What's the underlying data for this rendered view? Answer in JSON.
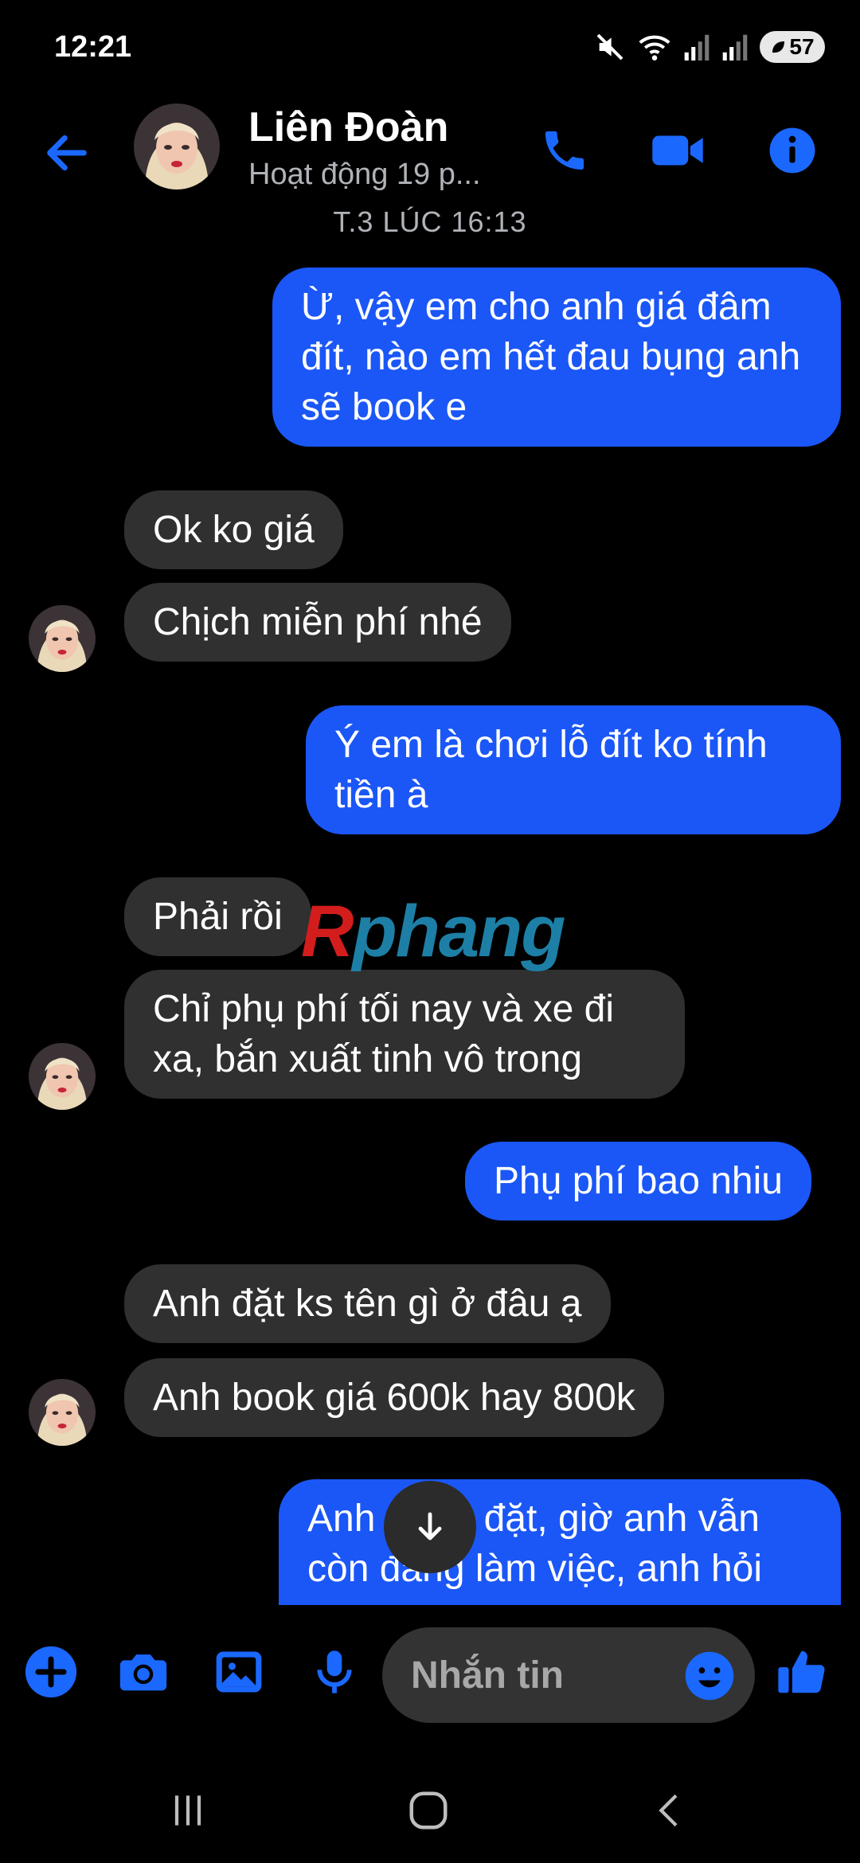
{
  "status_bar": {
    "time": "12:21",
    "battery": "57"
  },
  "header": {
    "contact_name": "Liên Đoàn",
    "contact_status": "Hoạt động 19 p..."
  },
  "timestamp": "T.3 LÚC 16:13",
  "messages": [
    {
      "side": "out",
      "text": "Ừ, vậy em cho anh giá đâm đít, nào em hết đau bụng anh sẽ book e"
    },
    {
      "side": "in",
      "text": "Ok ko giá"
    },
    {
      "side": "in",
      "text": "Chịch miễn phí nhé"
    },
    {
      "side": "out",
      "text": "Ý em là chơi lỗ đít ko tính tiền à"
    },
    {
      "side": "in",
      "text": "Phải rồi"
    },
    {
      "side": "in",
      "text": "Chỉ phụ phí tối nay và xe đi xa, bắn xuất tinh vô trong"
    },
    {
      "side": "out",
      "text": "Phụ phí bao nhiu"
    },
    {
      "side": "in",
      "text": "Anh đặt ks tên gì ở đâu ạ"
    },
    {
      "side": "in",
      "text": "Anh book giá 600k hay 800k"
    },
    {
      "side": "out",
      "text": "Anh chưa đặt, giờ anh vẫn còn đang làm việc, anh hỏi"
    }
  ],
  "watermark": {
    "first": "R",
    "rest": "phang"
  },
  "composer": {
    "placeholder": "Nhắn tin"
  },
  "colors": {
    "accent": "#1b57f6",
    "outgoing_bubble": "#1b57f6",
    "incoming_bubble": "#303030",
    "background": "#000000"
  },
  "icons": [
    "back-arrow-icon",
    "phone-icon",
    "video-camera-icon",
    "info-icon",
    "plus-icon",
    "camera-icon",
    "image-icon",
    "microphone-icon",
    "emoji-icon",
    "thumbs-up-icon",
    "arrow-down-icon",
    "recent-apps-icon",
    "home-icon",
    "back-nav-icon"
  ]
}
